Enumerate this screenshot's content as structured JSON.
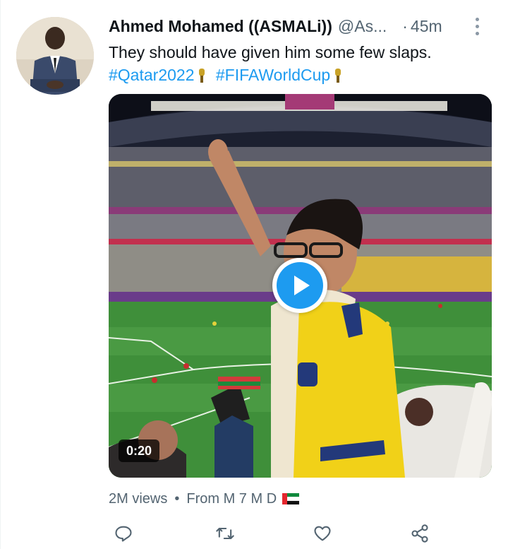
{
  "tweet": {
    "author_name": "Ahmed Mohamed ((ASMALi))",
    "author_handle": "@As...",
    "separator": "·",
    "timestamp": "45m",
    "text": "They should have given him some few slaps.",
    "hashtags": [
      "#Qatar2022",
      "#FIFAWorldCup"
    ],
    "hashtag_emojis": [
      "🏆",
      "🏆"
    ]
  },
  "media": {
    "type": "video",
    "duration": "0:20",
    "play_icon": "play-icon"
  },
  "meta": {
    "views": "2M views",
    "dot": "•",
    "from": "From M 7 M D",
    "flag": "uae-flag-icon"
  },
  "actions": [
    "reply-icon",
    "retweet-icon",
    "like-icon",
    "share-icon"
  ],
  "colors": {
    "accent": "#1d9bf0",
    "text": "#0f1419",
    "secondary": "#536471"
  }
}
